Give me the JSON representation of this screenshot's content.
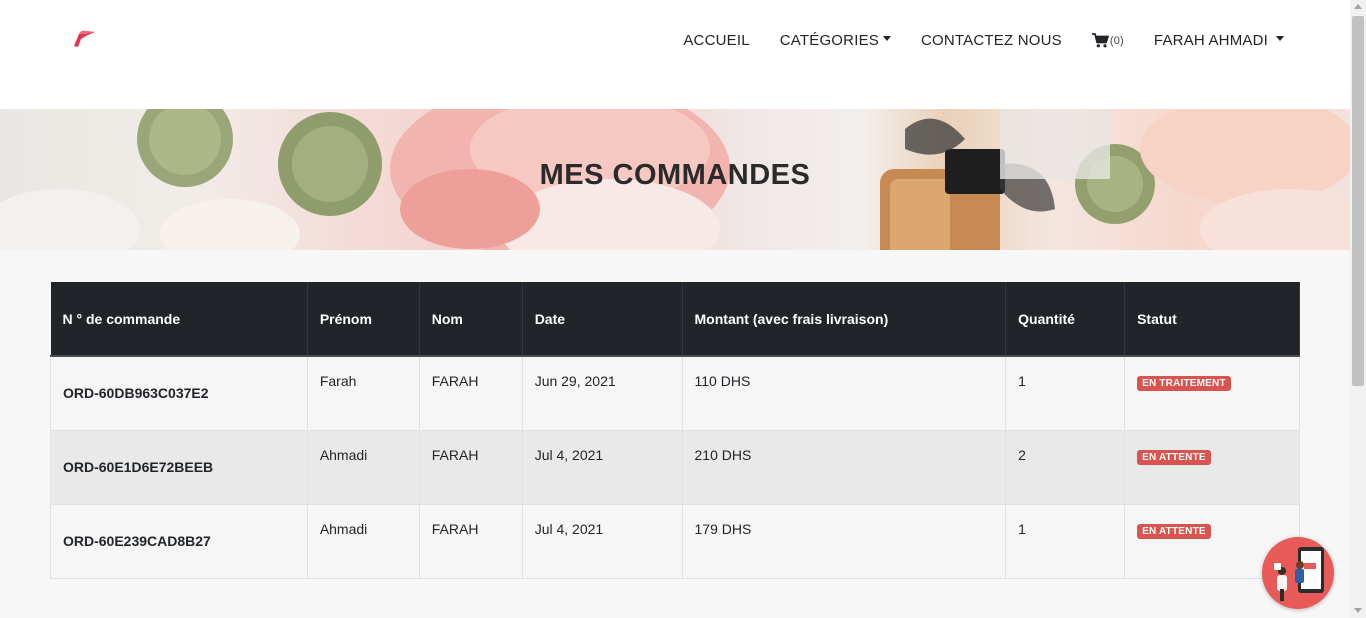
{
  "nav": {
    "items": [
      {
        "label": "ACCUEIL",
        "has_caret": false
      },
      {
        "label": "CATÉGORIES",
        "has_caret": true
      },
      {
        "label": "CONTACTEZ NOUS",
        "has_caret": false
      }
    ],
    "cart": {
      "icon": "cart-icon",
      "count": "(0)"
    },
    "user": {
      "label": "FARAH AHMADI",
      "has_caret": true
    }
  },
  "banner": {
    "title": "MES COMMANDES"
  },
  "orders": {
    "headers": [
      "N ° de commande",
      "Prénom",
      "Nom",
      "Date",
      "Montant (avec frais livraison)",
      "Quantité",
      "Statut"
    ],
    "rows": [
      {
        "order": "ORD-60DB963C037E2",
        "prenom": "Farah",
        "nom": "FARAH",
        "date": "Jun 29, 2021",
        "montant": "110 DHS",
        "quantite": "1",
        "statut": "EN TRAITEMENT"
      },
      {
        "order": "ORD-60E1D6E72BEEB",
        "prenom": "Ahmadi",
        "nom": "FARAH",
        "date": "Jul 4, 2021",
        "montant": "210 DHS",
        "quantite": "2",
        "statut": "EN ATTENTE"
      },
      {
        "order": "ORD-60E239CAD8B27",
        "prenom": "Ahmadi",
        "nom": "FARAH",
        "date": "Jul 4, 2021",
        "montant": "179 DHS",
        "quantite": "1",
        "statut": "EN ATTENTE"
      }
    ]
  },
  "colors": {
    "badge": "#d9534f",
    "header_bg": "#212529",
    "chat_bg": "#e85a57"
  }
}
